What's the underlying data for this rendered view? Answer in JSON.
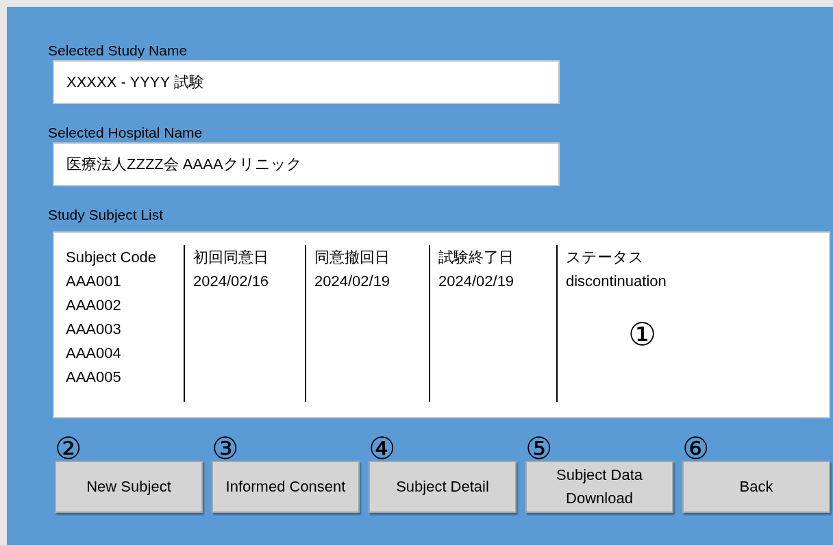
{
  "study": {
    "label": "Selected Study Name",
    "value": "XXXXX - YYYY 試験"
  },
  "hospital": {
    "label": "Selected Hospital Name",
    "value": "医療法人ZZZZ会 AAAAクリニック"
  },
  "subject_list": {
    "label": "Study Subject List",
    "marker": "①",
    "columns": [
      {
        "header": "Subject Code",
        "cells": [
          "AAA001",
          "AAA002",
          "AAA003",
          "AAA004",
          "AAA005"
        ]
      },
      {
        "header": "初回同意日",
        "cells": [
          "2024/02/16"
        ]
      },
      {
        "header": "同意撤回日",
        "cells": [
          "2024/02/19"
        ]
      },
      {
        "header": "試験終了日",
        "cells": [
          "2024/02/19"
        ]
      },
      {
        "header": "ステータス",
        "cells": [
          "discontinuation"
        ]
      }
    ]
  },
  "buttons": [
    {
      "marker": "②",
      "label": "New Subject"
    },
    {
      "marker": "③",
      "label": "Informed Consent"
    },
    {
      "marker": "④",
      "label": "Subject Detail"
    },
    {
      "marker": "⑤",
      "label": "Subject Data Download"
    },
    {
      "marker": "⑥",
      "label": "Back"
    }
  ]
}
